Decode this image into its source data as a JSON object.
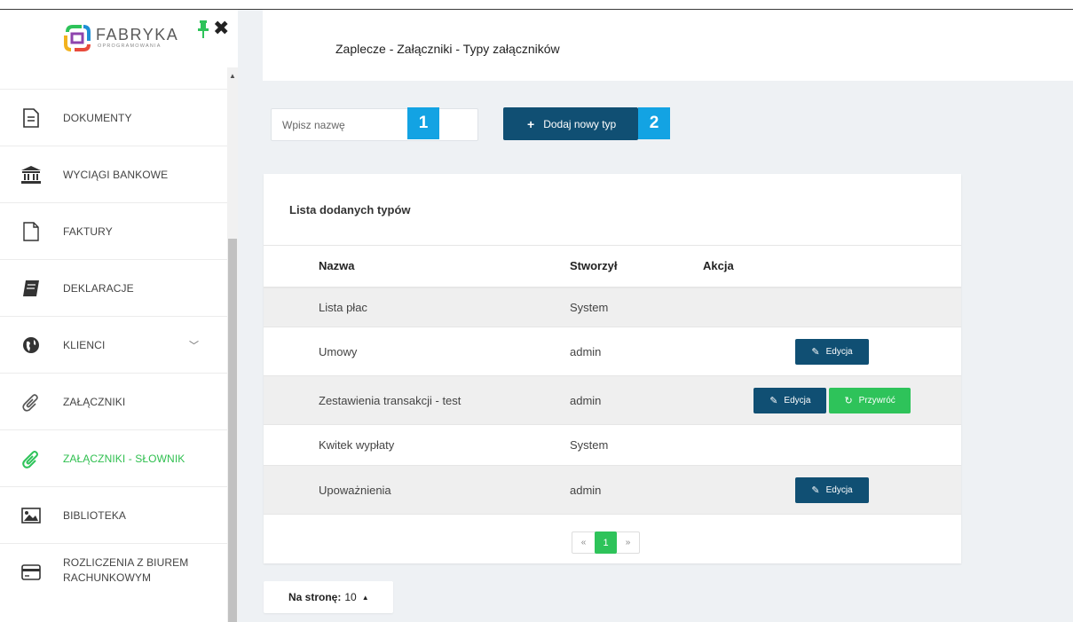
{
  "brand": {
    "name": "FABRYKA",
    "sub": "OPROGRAMOWANIA"
  },
  "colors": {
    "primary": "#104f73",
    "accent_green": "#2ec35a",
    "marker_blue": "#13a3e3",
    "main_bg": "#eef1f4"
  },
  "sidebar": {
    "items": [
      {
        "label": "DOKUMENTY",
        "icon": "document-icon"
      },
      {
        "label": "WYCIĄGI BANKOWE",
        "icon": "bank-icon"
      },
      {
        "label": "FAKTURY",
        "icon": "file-icon"
      },
      {
        "label": "DEKLARACJE",
        "icon": "book-icon"
      },
      {
        "label": "KLIENCI",
        "icon": "globe-icon",
        "has_submenu": true
      },
      {
        "label": "ZAŁĄCZNIKI",
        "icon": "paperclip-icon"
      },
      {
        "label": "ZAŁĄCZNIKI - SŁOWNIK",
        "icon": "paperclip-icon",
        "active": true
      },
      {
        "label": "BIBLIOTEKA",
        "icon": "image-icon"
      },
      {
        "label": "ROZLICZENIA Z BIUREM RACHUNKOWYM",
        "line1": "ROZLICZENIA Z BIUREM",
        "line2": "RACHUNKOWYM",
        "icon": "card-icon"
      }
    ]
  },
  "header": {
    "title": "Zaplecze - Załączniki - Typy załączników"
  },
  "search": {
    "placeholder": "Wpisz nazwę",
    "value": ""
  },
  "markers": {
    "first": "1",
    "second": "2"
  },
  "add_button": {
    "label": "Dodaj nowy typ"
  },
  "panel": {
    "title": "Lista dodanych typów",
    "columns": {
      "name": "Nazwa",
      "creator": "Stworzył",
      "action": "Akcja"
    },
    "rows": [
      {
        "name": "Lista płac",
        "creator": "System"
      },
      {
        "name": "Umowy",
        "creator": "admin"
      },
      {
        "name": "Zestawienia transakcji - test",
        "creator": "admin"
      },
      {
        "name": "Kwitek wypłaty",
        "creator": "System"
      },
      {
        "name": "Upoważnienia",
        "creator": "admin"
      }
    ],
    "edit_label": "Edycja",
    "restore_label": "Przywróć"
  },
  "pagination": {
    "prev": "«",
    "current": "1",
    "next": "»"
  },
  "per_page": {
    "label": "Na stronę:",
    "value": "10"
  }
}
